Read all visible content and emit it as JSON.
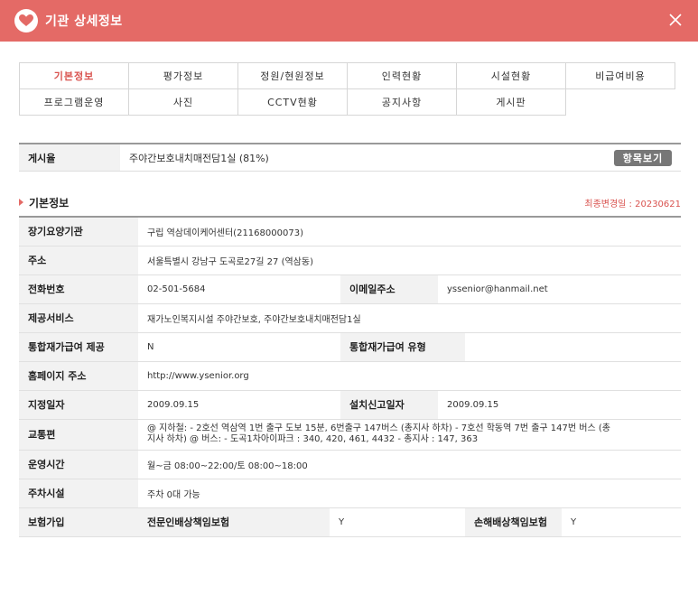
{
  "window": {
    "title": "기관 상세정보"
  },
  "tabs": [
    [
      "기본정보",
      "평가정보",
      "정원/현원정보",
      "인력현황",
      "시설현황",
      "비급여비용"
    ],
    [
      "프로그램운영",
      "사진",
      "CCTV현황",
      "공지사항",
      "게시판"
    ]
  ],
  "summary": {
    "label": "게시율",
    "value": "주야간보호내치매전담1실 (81%)",
    "button": "항목보기"
  },
  "section": {
    "title": "기본정보",
    "last_modified": "최종변경일 : 20230621"
  },
  "info": {
    "org_label": "장기요양기관",
    "org_value": "구립 역삼데이케어센터(21168000073)",
    "addr_label": "주소",
    "addr_value": "서울특별시 강남구 도곡로27길 27 (역삼동)",
    "phone_label": "전화번호",
    "phone_value": "02-501-5684",
    "email_label": "이메일주소",
    "email_value": "yssenior@hanmail.net",
    "service_label": "제공서비스",
    "service_value": "재가노인복지시설 주야간보호, 주야간보호내치매전담1실",
    "integ_label": "통합재가급여 제공",
    "integ_value": "N",
    "integ_type_label": "통합재가급여 유형",
    "integ_type_value": "",
    "home_label": "홈페이지 주소",
    "home_value": "http://www.ysenior.org",
    "designated_label": "지정일자",
    "designated_value": "2009.09.15",
    "install_label": "설치신고일자",
    "install_value": "2009.09.15",
    "transport_label": "교통편",
    "transport_line1": "@ 지하철: - 2호선 역삼역 1번 출구 도보 15분, 6번출구 147버스 (총지사 하차) - 7호선 학동역 7번 출구 147번 버스 (총",
    "transport_line2": "지사 하차) @ 버스: - 도곡1차아이파크 : 340, 420, 461, 4432 - 총지사 : 147, 363",
    "hours_label": "운영시간",
    "hours_value": "월~금 08:00~22:00/토 08:00~18:00",
    "parking_label": "주차시설",
    "parking_value": "주차 0대 가능",
    "insurance_label": "보험가입",
    "prof_ins_label": "전문인배상책임보험",
    "prof_ins_value": "Y",
    "damage_ins_label": "손해배상책임보험",
    "damage_ins_value": "Y"
  },
  "colors": {
    "header": "#e46a66",
    "accent": "#d9534f"
  },
  "icons": {
    "logo": "heart-logo-icon",
    "close": "close-icon",
    "section": "arrow-right-icon"
  }
}
